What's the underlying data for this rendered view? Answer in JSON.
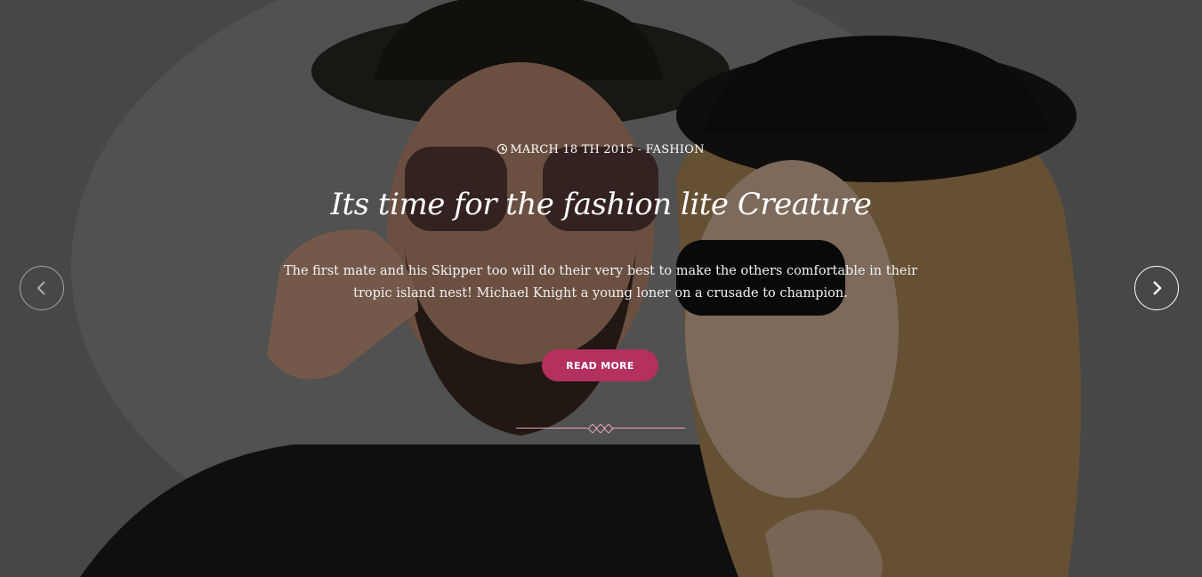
{
  "slide": {
    "meta_date": "MARCH 18 TH 2015",
    "meta_separator": " - ",
    "meta_category": "FASHION",
    "title": "Its time for the fashion lite Creature",
    "description": "The first mate and his Skipper too will do their very best to make the others comfortable in their tropic island nest! Michael Knight a young loner on a crusade to champion.",
    "read_more_label": "READ MORE"
  },
  "icons": {
    "clock": "clock-icon",
    "prev": "chevron-left-icon",
    "next": "chevron-right-icon"
  },
  "colors": {
    "accent": "#b4305e",
    "divider": "#e6a7bd",
    "overlay": "rgba(0,0,0,0.42)"
  }
}
